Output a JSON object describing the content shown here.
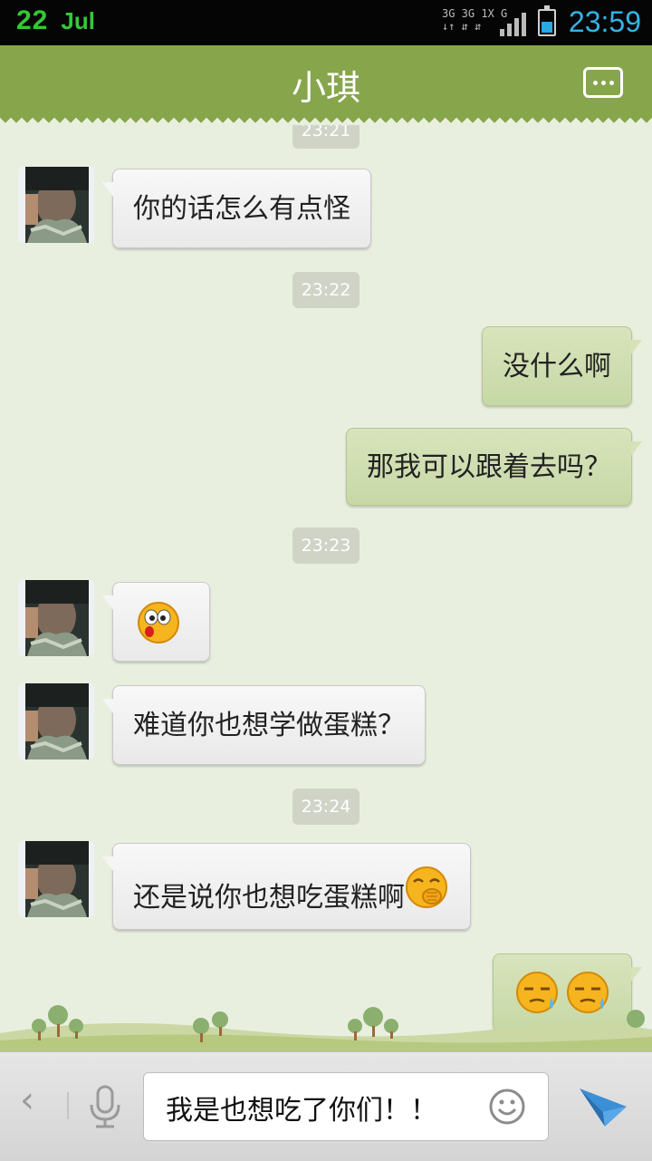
{
  "status_bar": {
    "day": "22",
    "month": "Jul",
    "network_top": "3G 3G 1X  G",
    "network_bottom": "↓↑ ⇵ ⇵",
    "time": "23:59",
    "battery_level": 0.55,
    "colors": {
      "date": "#34c83a",
      "time": "#33b5e5",
      "battery": "#2aa9e0"
    }
  },
  "header": {
    "title": "小琪",
    "menu_icon": "more-dots-icon",
    "background": "#87a64c"
  },
  "chat": {
    "timestamps": [
      "23:21",
      "23:22",
      "23:23",
      "23:24"
    ],
    "messages": [
      {
        "side": "incoming",
        "text": "你的话怎么有点怪"
      },
      {
        "side": "outgoing",
        "text": "没什么啊"
      },
      {
        "side": "outgoing",
        "text": "那我可以跟着去吗？"
      },
      {
        "side": "incoming",
        "emoji": "surprised-face-emoji"
      },
      {
        "side": "incoming",
        "text": "难道你也想学做蛋糕？"
      },
      {
        "side": "incoming",
        "text": "还是说你也想吃蛋糕啊",
        "emoji": "giggle-face-emoji"
      },
      {
        "side": "outgoing",
        "emoji": "sweat-face-emoji ×2"
      }
    ]
  },
  "input_bar": {
    "back_icon": "chevron-left-icon",
    "mic_icon": "microphone-icon",
    "text_value": "我是也想吃了你们！！",
    "emoji_icon": "smiley-icon",
    "send_icon": "send-plane-icon"
  }
}
